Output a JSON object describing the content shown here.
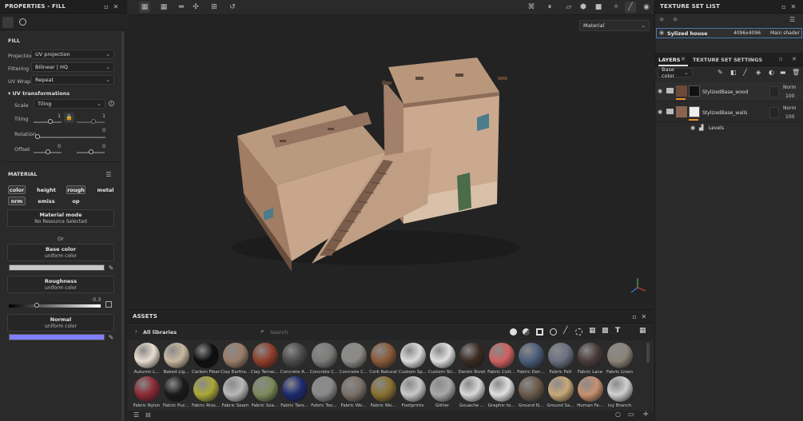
{
  "properties": {
    "title": "PROPERTIES - FILL",
    "section_fill": "FILL",
    "projection_label": "Projection",
    "projection_value": "UV projection",
    "filtering_label": "Filtering",
    "filtering_value": "Bilinear | HQ",
    "uvwrap_label": "UV Wrap",
    "uvwrap_value": "Repeat",
    "uv_transformations": "UV transformations",
    "scale_label": "Scale",
    "scale_value": "Tiling",
    "tiling_label": "Tiling",
    "tiling_value_1": "1",
    "tiling_value_2": "1",
    "rotation_label": "Rotation",
    "rotation_value": "0",
    "offset_label": "Offset",
    "offset_value_1": "0",
    "offset_value_2": "0",
    "section_material": "MATERIAL",
    "channels": [
      "color",
      "height",
      "rough",
      "metal",
      "nrm",
      "emiss",
      "op"
    ],
    "material_mode_title": "Material mode",
    "material_mode_value": "No Resource Selected",
    "or_text": "Or",
    "base_color_title": "Base color",
    "base_color_sub": "uniform color",
    "base_color_swatch": "#c8c8c8",
    "roughness_title": "Roughness",
    "roughness_sub": "uniform color",
    "roughness_value": "0.3",
    "roughness_fraction": 0.3,
    "normal_title": "Normal",
    "normal_sub": "uniform color",
    "normal_swatch": "#8080ff"
  },
  "viewport": {
    "mode_select": "Material"
  },
  "texture_set_list": {
    "title": "TEXTURE SET LIST",
    "set_name": "Sylized house",
    "set_size": "4096x4096",
    "set_shader": "Main shader"
  },
  "layers": {
    "tab_layers": "LAYERS",
    "tab_settings": "TEXTURE SET SETTINGS",
    "channel_select": "Base color",
    "items": [
      {
        "name": "StylizedBase_wood",
        "blend": "Norm",
        "opacity": "100"
      },
      {
        "name": "StylizedBase_walls",
        "blend": "Norm",
        "opacity": "100"
      }
    ],
    "filter_name": "Levels"
  },
  "assets": {
    "title": "ASSETS",
    "libraries": "All libraries",
    "search_placeholder": "Search",
    "row1": [
      {
        "label": "Autumn L...",
        "color": "#e8ddd0"
      },
      {
        "label": "Baked Lig...",
        "color": "#c9b8a0"
      },
      {
        "label": "Carbon Fiber",
        "color": "#0e0e0e"
      },
      {
        "label": "Clay Earthe...",
        "color": "#9a7d68"
      },
      {
        "label": "Clay Terrac...",
        "color": "#8f3d2a"
      },
      {
        "label": "Concrete A...",
        "color": "#4a4a4a"
      },
      {
        "label": "Concrete C...",
        "color": "#7a7a78"
      },
      {
        "label": "Concrete C...",
        "color": "#8c8a86"
      },
      {
        "label": "Cork Natural",
        "color": "#8a5a3a"
      },
      {
        "label": "Custom Sp...",
        "color": "#dcdcdc"
      },
      {
        "label": "Custom Sti...",
        "color": "#e0e0e0"
      },
      {
        "label": "Denim Rivet",
        "color": "#3a2a22"
      },
      {
        "label": "Fabric Cott...",
        "color": "#d06060"
      },
      {
        "label": "Fabric Den...",
        "color": "#4a5d7a"
      },
      {
        "label": "Fabric Felt",
        "color": "#6a7080"
      },
      {
        "label": "Fabric Lace",
        "color": "#4a3a3a"
      },
      {
        "label": "Fabric Linen",
        "color": "#8c8478"
      }
    ],
    "row2": [
      {
        "label": "Fabric Nylon",
        "color": "#8c2a34"
      },
      {
        "label": "Fabric Puc...",
        "color": "#1a1a1a"
      },
      {
        "label": "Fabric Rios...",
        "color": "#a9a838"
      },
      {
        "label": "Fabric Seam",
        "color": "#b8b8b8"
      },
      {
        "label": "Fabric Soa...",
        "color": "#7d8a5a"
      },
      {
        "label": "Fabric Taro...",
        "color": "#1d2a70"
      },
      {
        "label": "Fabric Too...",
        "color": "#8a8a8a"
      },
      {
        "label": "Fabric Wo...",
        "color": "#7a7068"
      },
      {
        "label": "Fabric Wo...",
        "color": "#8a7030"
      },
      {
        "label": "Footprints",
        "color": "#c8c8c8"
      },
      {
        "label": "Glitter",
        "color": "#a8a8a8"
      },
      {
        "label": "Gouache ...",
        "color": "#d8d8d8"
      },
      {
        "label": "Graphic to...",
        "color": "#e0e0e0"
      },
      {
        "label": "Ground N...",
        "color": "#6a5a4a"
      },
      {
        "label": "Ground Sa...",
        "color": "#c8a878"
      },
      {
        "label": "Human Fa...",
        "color": "#c89070"
      },
      {
        "label": "Ivy Branch",
        "color": "#d0d0d0"
      }
    ]
  },
  "colors": {
    "accent": "#f0902a",
    "selected": "#4a78b0"
  }
}
